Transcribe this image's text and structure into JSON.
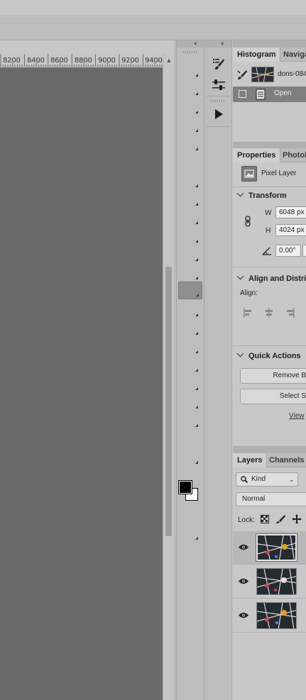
{
  "ruler": {
    "labels": [
      "8200",
      "8400",
      "8600",
      "8800",
      "9000",
      "9200",
      "9400"
    ]
  },
  "panels": {
    "history": {
      "tabs": [
        "Histogram",
        "Naviga"
      ],
      "snapshot_name": "dons-084",
      "state_label": "Open"
    },
    "properties": {
      "tabs": [
        "Properties",
        "Photob"
      ],
      "layer_type": "Pixel Layer",
      "transform": {
        "title": "Transform",
        "w_label": "W",
        "w_value": "6048 px",
        "h_label": "H",
        "h_value": "4024 px",
        "angle_value": "0.00°"
      },
      "align": {
        "title": "Align and Distri",
        "label": "Align:"
      },
      "quick_actions": {
        "title": "Quick Actions",
        "remove_bg_label": "Remove B",
        "select_subject_label": "Select S",
        "view_link": "View"
      }
    },
    "layers": {
      "tabs": [
        "Layers",
        "Channels"
      ],
      "filter_kind": "Kind",
      "blend_mode": "Normal",
      "lock_label": "Lock:"
    }
  },
  "colors": {
    "canvas_bg": "#6a6a6a",
    "panel_bg": "#c8c8c8",
    "foreground": "#000000",
    "background": "#ffffff"
  }
}
